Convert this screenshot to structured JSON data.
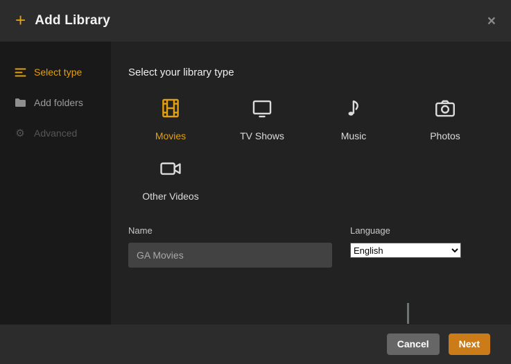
{
  "header": {
    "title": "Add Library",
    "plus_glyph": "+",
    "close_glyph": "×"
  },
  "sidebar": {
    "items": [
      {
        "label": "Select type",
        "icon": "list-lines-icon",
        "state": "active"
      },
      {
        "label": "Add folders",
        "icon": "folder-icon",
        "state": "normal"
      },
      {
        "label": "Advanced",
        "icon": "gear-icon",
        "state": "disabled"
      }
    ],
    "gear_glyph": "⚙"
  },
  "content": {
    "heading": "Select your library type",
    "types": [
      {
        "label": "Movies",
        "icon": "film-frame-icon",
        "selected": true
      },
      {
        "label": "TV Shows",
        "icon": "tv-monitor-icon",
        "selected": false
      },
      {
        "label": "Music",
        "icon": "music-note-icon",
        "selected": false
      },
      {
        "label": "Photos",
        "icon": "camera-icon",
        "selected": false
      },
      {
        "label": "Other Videos",
        "icon": "video-camera-icon",
        "selected": false
      }
    ],
    "name_field": {
      "label": "Name",
      "value": "GA Movies"
    },
    "language_field": {
      "label": "Language",
      "value": "English"
    }
  },
  "footer": {
    "cancel_label": "Cancel",
    "next_label": "Next"
  },
  "colors": {
    "accent_gold": "#e5a00d",
    "next_orange": "#cc7b19",
    "sidebar_bg": "#191919",
    "header_bg": "#2c2c2c",
    "content_bg": "#222222"
  }
}
